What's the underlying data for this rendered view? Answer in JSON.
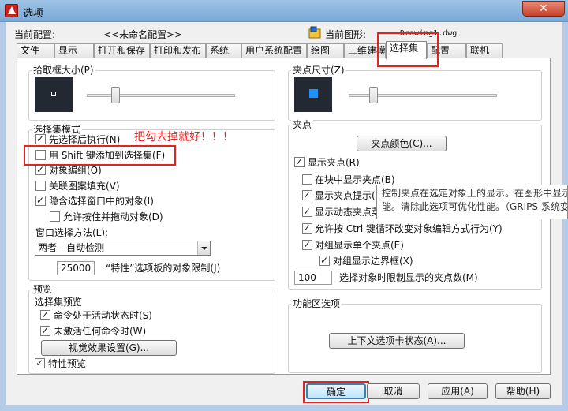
{
  "window": {
    "title": "选项",
    "close_glyph": "✕"
  },
  "profile": {
    "current_config_label": "当前配置:",
    "current_config_value": "<<未命名配置>>",
    "current_drawing_label": "当前图形:",
    "current_drawing_value": "Drawing1.dwg"
  },
  "tabs": [
    "文件",
    "显示",
    "打开和保存",
    "打印和发布",
    "系统",
    "用户系统配置",
    "绘图",
    "三维建模",
    "选择集",
    "配置",
    "联机"
  ],
  "active_tab": "选择集",
  "pickbox": {
    "label": "拾取框大小(P)",
    "level": 0.3
  },
  "grip_size": {
    "label": "夹点尺寸(Z)",
    "level": 0.25
  },
  "selection_modes": {
    "label": "选择集模式",
    "noun_verb": {
      "label": "先选择后执行(N)",
      "checked": true
    },
    "shift_add": {
      "label": "用 Shift 键添加到选择集(F)",
      "checked": false
    },
    "object_group": {
      "label": "对象编组(O)",
      "checked": true
    },
    "assoc_hatch": {
      "label": "关联图案填充(V)",
      "checked": false
    },
    "implied_window": {
      "label": "隐含选择窗口中的对象(I)",
      "checked": true
    },
    "press_drag": {
      "label": "允许按住并拖动对象(D)",
      "checked": false
    },
    "window_method_label": "窗口选择方法(L):",
    "window_method_value": "两者 - 自动检测",
    "limit_value": "25000",
    "limit_label": "“特性”选项板的对象限制(J)"
  },
  "annotation": {
    "text": "把勾去掉就好！！！",
    "color": "#e32222"
  },
  "preview": {
    "label": "预览",
    "selection_preview_label": "选择集预览",
    "cmd_active": {
      "label": "命令处于活动状态时(S)",
      "checked": true
    },
    "no_cmd": {
      "label": "未激活任何命令时(W)",
      "checked": true
    },
    "visual_effects_button": "视觉效果设置(G)...",
    "property_preview": {
      "label": "特性预览",
      "checked": true
    }
  },
  "grips": {
    "label": "夹点",
    "grip_color_button": "夹点颜色(C)...",
    "show_grips": {
      "label": "显示夹点(R)",
      "checked": true
    },
    "show_in_blocks": {
      "label": "在块中显示夹点(B)",
      "checked": false
    },
    "show_tips": {
      "label": "显示夹点提示(T)",
      "checked": true
    },
    "dynamic_menu": {
      "label": "显示动态夹点菜单(U)",
      "checked": true
    },
    "ctrl_cycle": {
      "label": "允许按 Ctrl 键循环改变对象编辑方式行为(Y)",
      "checked": true
    },
    "single_group": {
      "label": "对组显示单个夹点(E)",
      "checked": true
    },
    "bounding_box": {
      "label": "对组显示边界框(X)",
      "checked": true
    },
    "limit_value": "100",
    "limit_label": "选择对象时限制显示的夹点数(M)"
  },
  "tooltip": {
    "line1": "控制夹点在选定对象上的显示。在图形中显示",
    "line2": "能。清除此选项可优化性能。（GRIPS 系统变"
  },
  "ribbon": {
    "label": "功能区选项",
    "contextual_button": "上下文选项卡状态(A)..."
  },
  "buttons": {
    "ok": "确定",
    "cancel": "取消",
    "apply": "应用(A)",
    "help": "帮助(H)"
  },
  "colors": {
    "highlight": "#e32222",
    "grip_preview": "#1e90ff"
  }
}
